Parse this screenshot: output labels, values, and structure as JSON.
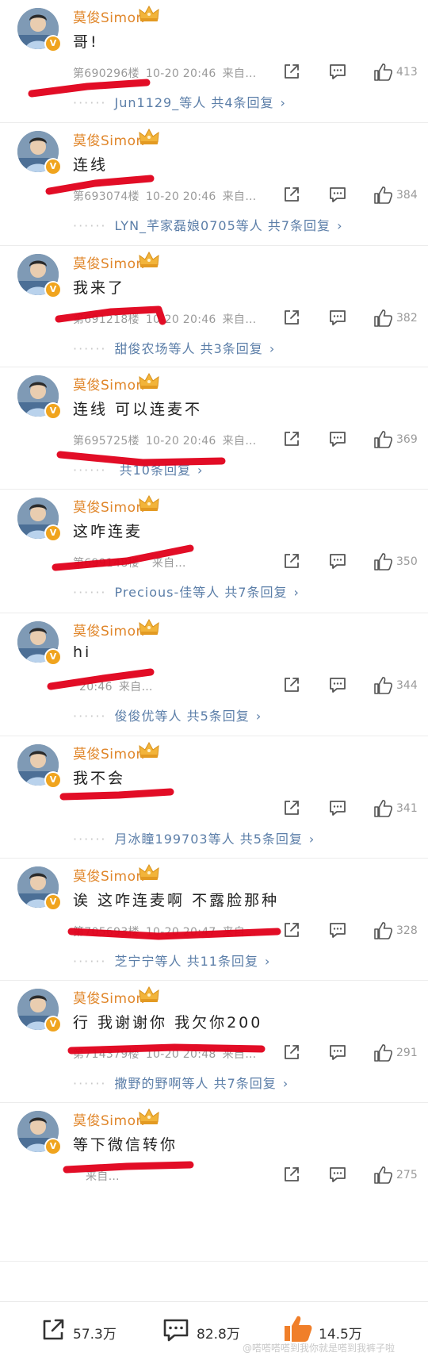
{
  "comments": [
    {
      "user": "莫俊Simon",
      "text": "哥!",
      "floor": "第690296楼",
      "time": "10-20 20:46",
      "source": "来自…",
      "likes": "413",
      "reply_users": "Jun1129_等人",
      "reply_count": "共4条回复"
    },
    {
      "user": "莫俊Simon",
      "text": "连线",
      "floor": "第693074楼",
      "time": "10-20 20:46",
      "source": "来自…",
      "likes": "384",
      "reply_users": "LYN_芊家磊娘0705等人",
      "reply_count": "共7条回复"
    },
    {
      "user": "莫俊Simon",
      "text": "我来了",
      "floor": "第691218楼",
      "time": "10-20 20:46",
      "source": "来自…",
      "likes": "382",
      "reply_users": "甜俊农场等人",
      "reply_count": "共3条回复"
    },
    {
      "user": "莫俊Simon",
      "text": "连线 可以连麦不",
      "floor": "第695725楼",
      "time": "10-20 20:46",
      "source": "来自…",
      "likes": "369",
      "reply_users": "",
      "reply_count": "共10条回复"
    },
    {
      "user": "莫俊Simon",
      "text": "这咋连麦",
      "floor": "第699148楼",
      "time": "",
      "source": "来自…",
      "likes": "350",
      "reply_users": "Precious-佳等人",
      "reply_count": "共7条回复"
    },
    {
      "user": "莫俊Simon",
      "text": "hi",
      "floor": "",
      "time": "20:46",
      "source": "来自…",
      "likes": "344",
      "reply_users": "俊俊优等人",
      "reply_count": "共5条回复"
    },
    {
      "user": "莫俊Simon",
      "text": "我不会",
      "floor": "",
      "time": "",
      "source": "",
      "likes": "341",
      "reply_users": "月冰瞳199703等人",
      "reply_count": "共5条回复"
    },
    {
      "user": "莫俊Simon",
      "text": "诶 这咋连麦啊 不露脸那种",
      "floor": "第705693楼",
      "time": "10-20 20:47",
      "source": "来自…",
      "likes": "328",
      "reply_users": "芝宁宁等人",
      "reply_count": "共11条回复"
    },
    {
      "user": "莫俊Simon",
      "text": "行 我谢谢你 我欠你200",
      "floor": "第714379楼",
      "time": "10-20 20:48",
      "source": "来自…",
      "likes": "291",
      "reply_users": "撒野的野啊等人",
      "reply_count": "共7条回复"
    },
    {
      "user": "莫俊Simon",
      "text": "等下微信转你",
      "floor": "",
      "time": "",
      "source": "来自…",
      "likes": "275",
      "reply_users": "",
      "reply_count": ""
    }
  ],
  "bottom_bar": {
    "shares": "57.3万",
    "comments": "82.8万",
    "likes": "14.5万"
  },
  "watermark": "@嗒嗒嗒嗒到我你就是嗒到我裤子啦",
  "colors": {
    "username": "#e0862a",
    "reply_link": "#5b7ea8",
    "annotation": "#e0001a",
    "like_active": "#f07f2a"
  },
  "icons": {
    "share": "share-icon",
    "reply": "comment-icon",
    "like": "thumbs-up-icon",
    "verified": "verified-badge-icon",
    "crown": "crown-icon"
  }
}
